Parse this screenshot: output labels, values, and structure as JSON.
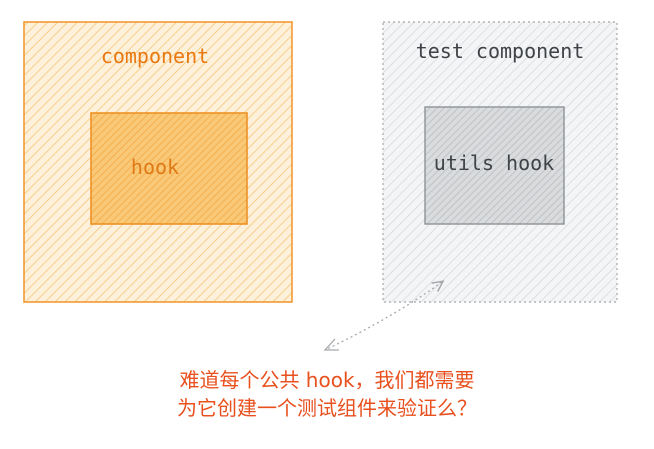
{
  "labels": {
    "component": "component",
    "hook": "hook",
    "test_component": "test component",
    "utils_hook": "utils hook"
  },
  "question": {
    "line1": "难道每个公共 hook，我们都需要",
    "line2": "为它创建一个测试组件来验证么？"
  },
  "colors": {
    "orange_border": "#f29a33",
    "orange_hatch": "#f7c676",
    "orange_label": "#e8780f",
    "inner_orange_fill": "#f6b85a",
    "hook_label": "#e07a16",
    "gray_border": "#b0b3b6",
    "gray_hatch": "#d5d8db",
    "gray_fill": "#d4d6d8",
    "gray_label": "#3f4246",
    "question_red": "#e8501e"
  }
}
